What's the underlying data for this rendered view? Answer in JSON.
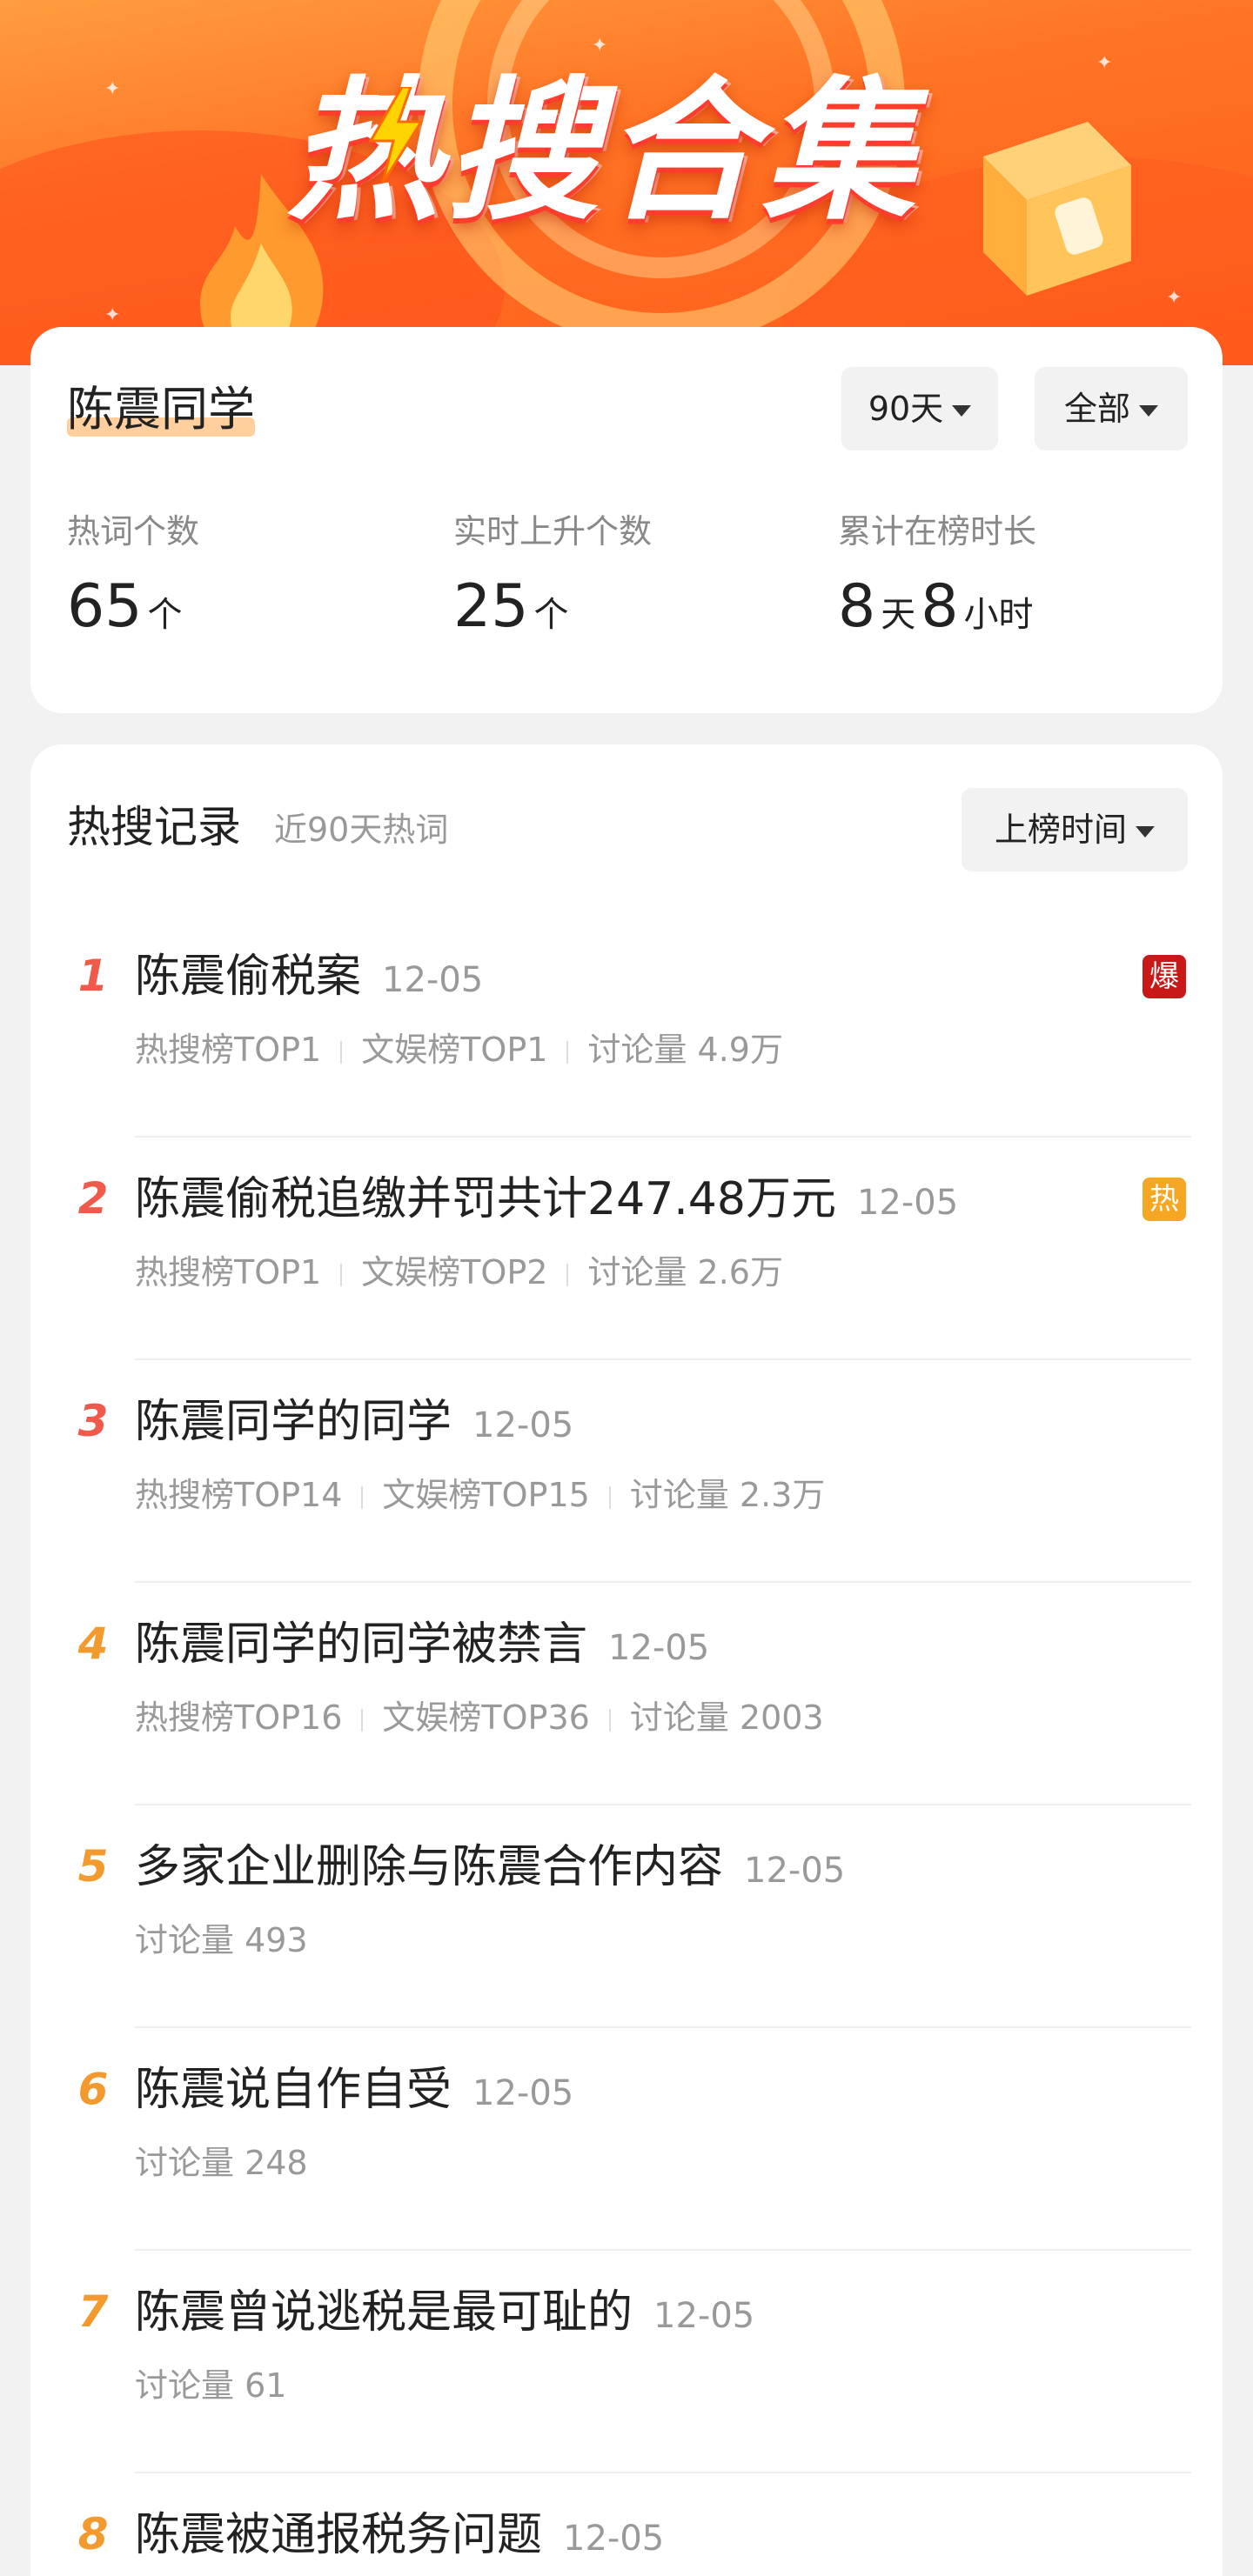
{
  "banner": {
    "title": "热搜合集"
  },
  "profile": {
    "name": "陈震同学",
    "period_filter": "90天",
    "scope_filter": "全部",
    "stats": {
      "keywords_label": "热词个数",
      "keywords_value": "65",
      "keywords_unit": "个",
      "rising_label": "实时上升个数",
      "rising_value": "25",
      "rising_unit": "个",
      "duration_label": "累计在榜时长",
      "duration_days": "8",
      "duration_days_unit": "天",
      "duration_hours": "8",
      "duration_hours_unit": "小时"
    }
  },
  "records": {
    "title": "热搜记录",
    "subtitle": "近90天热词",
    "sort_label": "上榜时间",
    "items": [
      {
        "rank": "1",
        "title": "陈震偷税案",
        "date": "12-05",
        "hot_rank": "热搜榜TOP1",
        "ent_rank": "文娱榜TOP1",
        "discussion": "讨论量 4.9万",
        "tag": "爆"
      },
      {
        "rank": "2",
        "title": "陈震偷税追缴并罚共计247.48万元",
        "date": "12-05",
        "hot_rank": "热搜榜TOP1",
        "ent_rank": "文娱榜TOP2",
        "discussion": "讨论量 2.6万",
        "tag": "热"
      },
      {
        "rank": "3",
        "title": "陈震同学的同学",
        "date": "12-05",
        "hot_rank": "热搜榜TOP14",
        "ent_rank": "文娱榜TOP15",
        "discussion": "讨论量 2.3万"
      },
      {
        "rank": "4",
        "title": "陈震同学的同学被禁言",
        "date": "12-05",
        "hot_rank": "热搜榜TOP16",
        "ent_rank": "文娱榜TOP36",
        "discussion": "讨论量 2003"
      },
      {
        "rank": "5",
        "title": "多家企业删除与陈震合作内容",
        "date": "12-05",
        "discussion": "讨论量 493"
      },
      {
        "rank": "6",
        "title": "陈震说自作自受",
        "date": "12-05",
        "discussion": "讨论量 248"
      },
      {
        "rank": "7",
        "title": "陈震曾说逃税是最可耻的",
        "date": "12-05",
        "discussion": "讨论量 61"
      },
      {
        "rank": "8",
        "title": "陈震被通报税务问题",
        "date": "12-05"
      }
    ]
  },
  "colors": {
    "rank_top": "#f05a4a",
    "rank_mid": "#f39a2e",
    "tag_explode": "#c81818",
    "tag_hot": "#f5a623",
    "highlight": "#ffcf9e"
  }
}
